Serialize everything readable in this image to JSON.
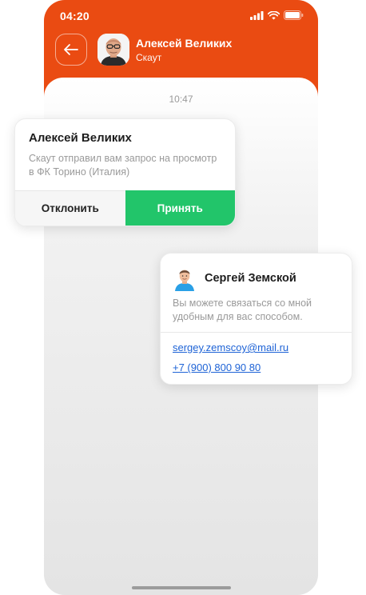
{
  "status_bar": {
    "time": "04:20"
  },
  "header": {
    "name": "Алексей Великих",
    "role": "Скаут"
  },
  "chat": {
    "time_separator": "10:47"
  },
  "request_card": {
    "title": "Алексей Великих",
    "text": "Скаут отправил вам запрос на просмотр в ФК Торино (Италия)",
    "decline_label": "Отклонить",
    "accept_label": "Принять"
  },
  "contact_card": {
    "name": "Сергей Земской",
    "text": "Вы можете связаться со мной удобным для вас способом.",
    "email": "sergey.zemscoy@mail.ru",
    "phone": "+7 (900) 800 90 80"
  },
  "colors": {
    "header_bg": "#ea4b12",
    "accept_bg": "#22c56a",
    "link": "#1e63d6"
  },
  "icons": {
    "back": "arrow-left-icon",
    "signal": "signal-icon",
    "wifi": "wifi-icon",
    "battery": "battery-icon"
  }
}
